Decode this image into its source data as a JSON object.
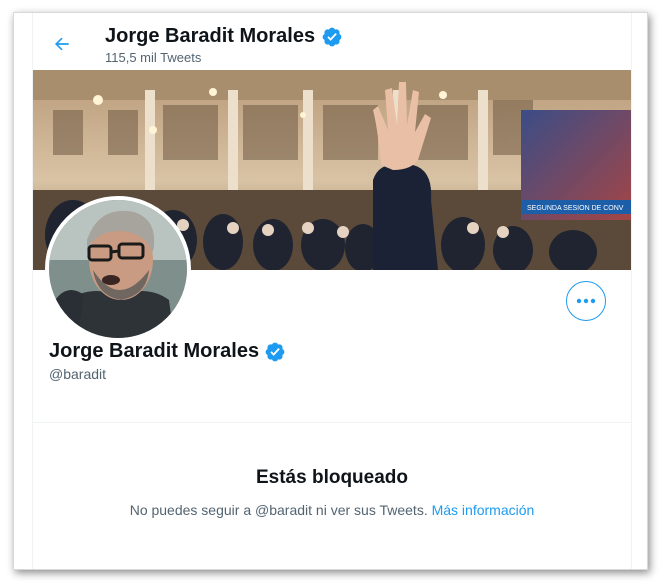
{
  "header": {
    "title": "Jorge Baradit Morales",
    "tweet_count": "115,5 mil Tweets"
  },
  "banner": {
    "screen_caption": "SEGUNDA SESION DE CONV"
  },
  "profile": {
    "name": "Jorge Baradit Morales",
    "handle": "@baradit",
    "verified": true
  },
  "blocked": {
    "title": "Estás bloqueado",
    "message": "No puedes seguir a @baradit ni ver sus Tweets.",
    "link": "Más información"
  },
  "colors": {
    "accent": "#1d9bf0",
    "text": "#0f1419",
    "secondary": "#536471"
  },
  "icons": {
    "back": "arrow-left-icon",
    "verified": "verified-badge-icon",
    "more": "more-dots-icon"
  }
}
